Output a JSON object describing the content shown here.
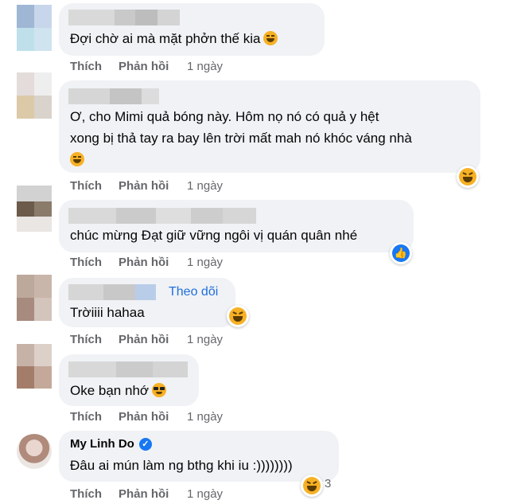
{
  "comments": [
    {
      "text": "Đợi chờ ai mà mặt phởn thế kia",
      "actions": {
        "like": "Thích",
        "reply": "Phản hồi",
        "time": "1 ngày"
      }
    },
    {
      "text_line1": "Ơ, cho Mimi quả bóng này. Hôm nọ nó có quả y hệt",
      "text_line2": "xong bị thả tay ra bay lên trời mất mah nó khóc váng nhà",
      "actions": {
        "like": "Thích",
        "reply": "Phản hồi",
        "time": "1 ngày"
      }
    },
    {
      "text": "chúc mừng Đạt giữ vững ngôi vị quán quân nhé",
      "actions": {
        "like": "Thích",
        "reply": "Phản hồi",
        "time": "1 ngày"
      }
    },
    {
      "follow": "Theo dõi",
      "text": "Trờiiii hahaa",
      "actions": {
        "like": "Thích",
        "reply": "Phản hồi",
        "time": "1 ngày"
      }
    },
    {
      "text": "Oke bạn nhớ",
      "actions": {
        "like": "Thích",
        "reply": "Phản hồi",
        "time": "1 ngày"
      }
    },
    {
      "author": "My Linh Do",
      "text": "Đâu ai mún làm ng bthg khi iu :))))))))",
      "reaction_count": "3",
      "actions": {
        "like": "Thích",
        "reply": "Phản hồi",
        "time": "1 ngày"
      }
    }
  ],
  "icons": {
    "haha": "haha-reaction-icon",
    "like": "like-reaction-icon",
    "cool": "sunglasses-emoji-icon",
    "verified": "verified-badge-icon"
  },
  "colors": {
    "bubble": "#f0f2f5",
    "secondary_text": "#65676b",
    "link": "#216fdb",
    "brand_blue": "#1877f2"
  }
}
